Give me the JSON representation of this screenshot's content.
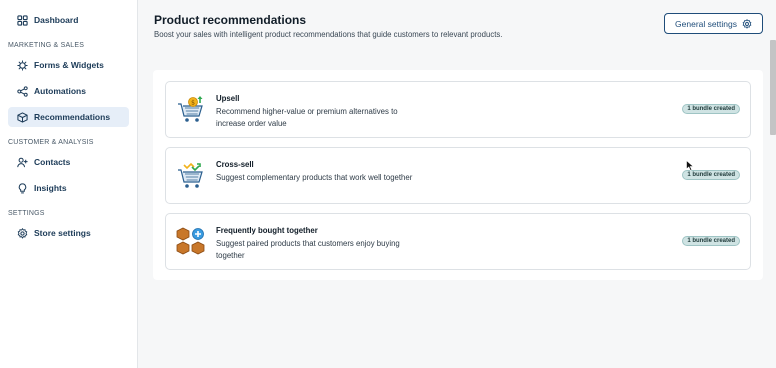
{
  "sidebar": {
    "dashboard": "Dashboard",
    "sections": {
      "marketing": "MARKETING & SALES",
      "customer": "CUSTOMER & ANALYSIS",
      "settings": "SETTINGS"
    },
    "items": {
      "forms": "Forms & Widgets",
      "automations": "Automations",
      "recommendations": "Recommendations",
      "contacts": "Contacts",
      "insights": "Insights",
      "store_settings": "Store settings"
    }
  },
  "main": {
    "title": "Product recommendations",
    "subtitle": "Boost your sales with intelligent product recommendations that guide customers to relevant products.",
    "settings_button": "General settings",
    "cards": [
      {
        "title": "Upsell",
        "description": "Recommend higher-value or premium alternatives to increase order value",
        "badge": "1 bundle created",
        "icon": "cart-upsell-icon"
      },
      {
        "title": "Cross-sell",
        "description": "Suggest complementary products that work well together",
        "badge": "1 bundle created",
        "icon": "cart-cross-sell-icon"
      },
      {
        "title": "Frequently bought together",
        "description": "Suggest paired products that customers enjoy buying together",
        "badge": "1 bundle created",
        "icon": "boxes-bundle-icon"
      }
    ]
  },
  "colors": {
    "accent": "#1f4d7a",
    "active_bg": "#e6eef8",
    "badge_bg": "#cfe3e3"
  }
}
